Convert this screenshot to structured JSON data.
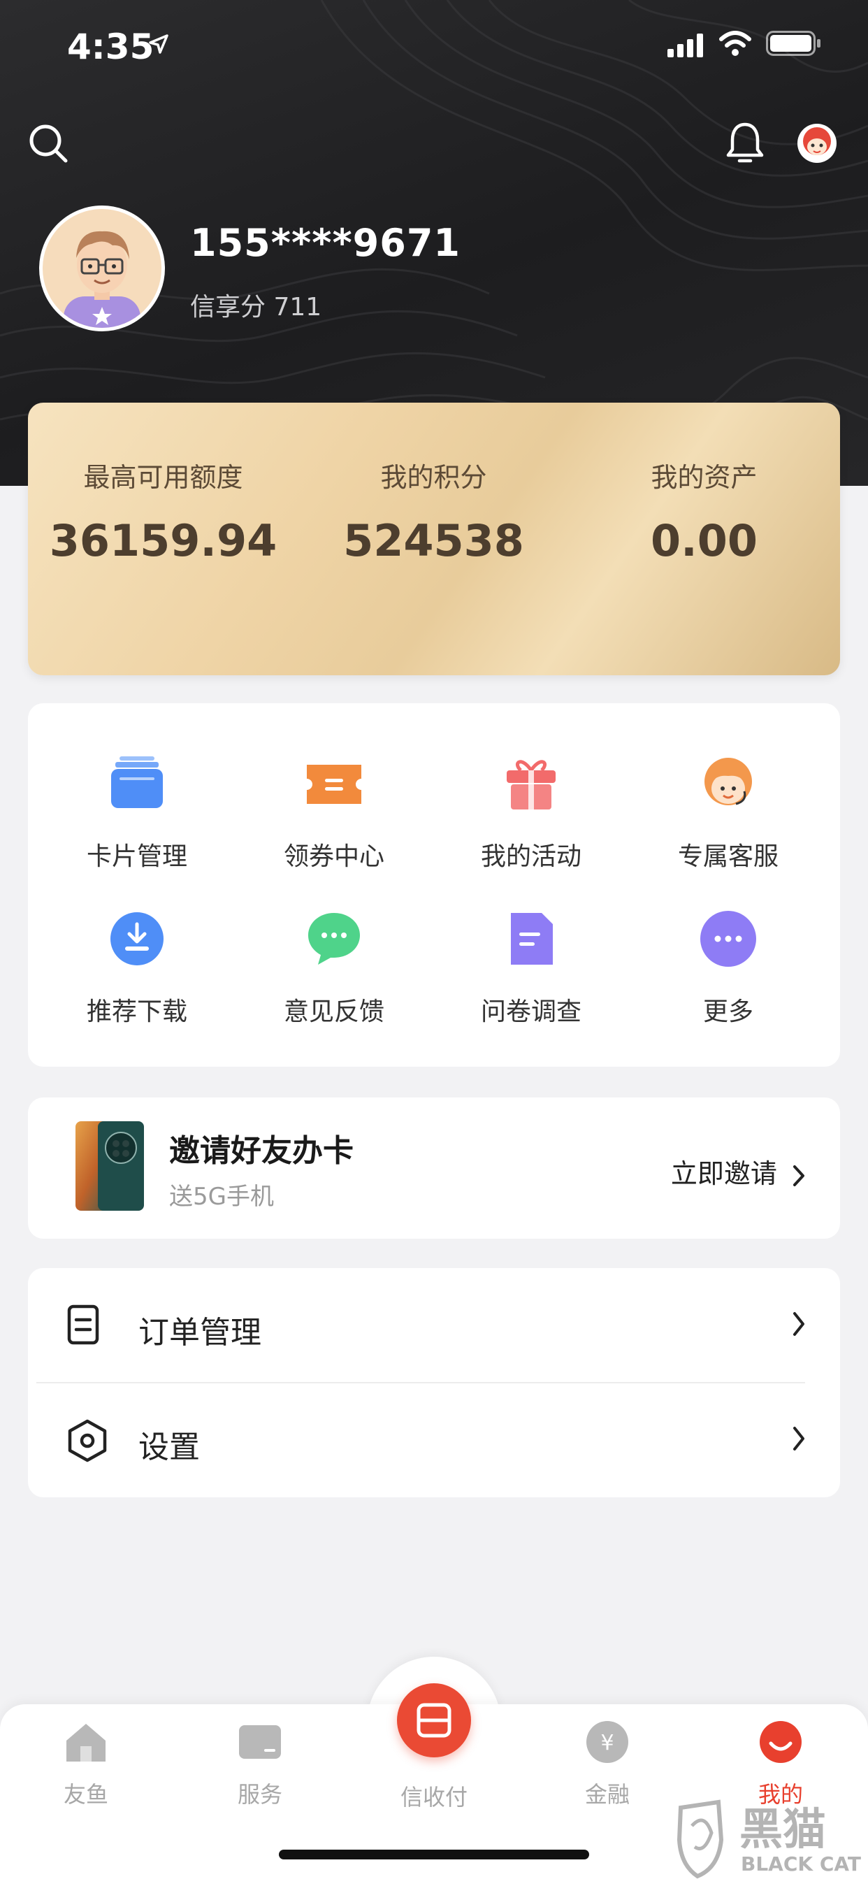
{
  "status_bar": {
    "time": "4:35"
  },
  "profile": {
    "phone": "155****9671",
    "credit_score": "信享分 711"
  },
  "summary": [
    {
      "label": "最高可用额度",
      "value": "36159.94"
    },
    {
      "label": "我的积分",
      "value": "524538"
    },
    {
      "label": "我的资产",
      "value": "0.00"
    }
  ],
  "quick_actions": [
    {
      "label": "卡片管理",
      "icon": "card-stack-icon",
      "color": "#4f8ef7"
    },
    {
      "label": "领券中心",
      "icon": "coupon-icon",
      "color": "#f28a3c"
    },
    {
      "label": "我的活动",
      "icon": "gift-icon",
      "color": "#f26b6b"
    },
    {
      "label": "专属客服",
      "icon": "customer-service-icon",
      "color": "#f3984c"
    },
    {
      "label": "推荐下载",
      "icon": "download-icon",
      "color": "#4f8ef7"
    },
    {
      "label": "意见反馈",
      "icon": "feedback-chat-icon",
      "color": "#4fd38a"
    },
    {
      "label": "问卷调查",
      "icon": "survey-document-icon",
      "color": "#8e7cf5"
    },
    {
      "label": "更多",
      "icon": "more-icon",
      "color": "#8e7cf5"
    }
  ],
  "invite": {
    "title": "邀请好友办卡",
    "subtitle": "送5G手机",
    "action": "立即邀请"
  },
  "menu": [
    {
      "label": "订单管理",
      "icon": "order-document-icon"
    },
    {
      "label": "设置",
      "icon": "settings-hexagon-icon"
    }
  ],
  "tabs": [
    {
      "label": "友鱼",
      "icon": "house-icon"
    },
    {
      "label": "服务",
      "icon": "service-card-icon"
    },
    {
      "label": "信收付",
      "icon": "scan-pay-icon"
    },
    {
      "label": "金融",
      "icon": "yen-icon"
    },
    {
      "label": "我的",
      "icon": "smile-face-icon",
      "active": true
    }
  ],
  "colors": {
    "accent": "#e8402e",
    "gold_text": "#4d3e2e",
    "header_bg": "#1f1f21"
  },
  "watermark": {
    "text_cn": "黑猫",
    "text_en": "BLACK CAT"
  }
}
